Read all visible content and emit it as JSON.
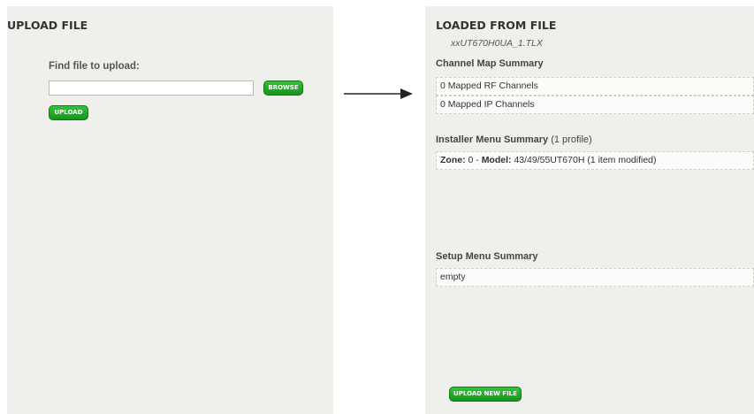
{
  "upload_panel": {
    "title": "UPLOAD FILE",
    "find_label": "Find file to upload:",
    "file_input_value": "",
    "browse_label": "BROWSE",
    "upload_label": "UPLOAD"
  },
  "loaded_panel": {
    "title": "LOADED FROM FILE",
    "filename": "xxUT670H0UA_1.TLX",
    "channel_map": {
      "title": "Channel Map Summary",
      "rows": [
        "0 Mapped RF Channels",
        "0 Mapped IP Channels"
      ]
    },
    "installer_menu": {
      "title": "Installer Menu Summary",
      "note": "(1 profile)",
      "row": {
        "zone_label": "Zone:",
        "zone_value": "0 -",
        "model_label": "Model:",
        "model_value": "43/49/55UT670H (1 item modified)"
      }
    },
    "setup_menu": {
      "title": "Setup Menu Summary",
      "row": "empty"
    },
    "upload_new_label": "UPLOAD NEW FILE"
  },
  "icons": {
    "arrow": "arrow-right-icon"
  },
  "colors": {
    "panel_bg": "#eff0ec",
    "button_green": "#1aa51f"
  }
}
